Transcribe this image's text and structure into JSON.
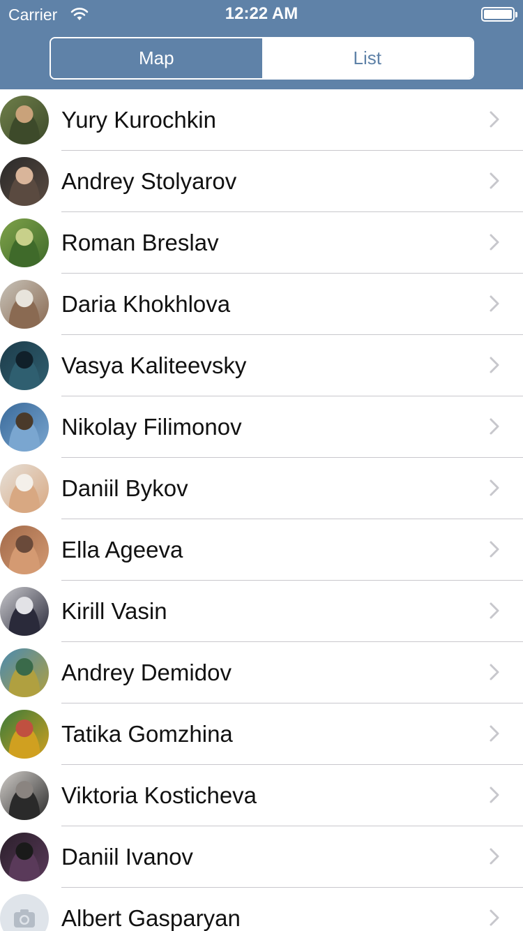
{
  "status_bar": {
    "carrier": "Carrier",
    "wifi_icon": "wifi-icon",
    "time": "12:22 AM",
    "battery_icon": "battery-icon",
    "battery_level": 1.0
  },
  "segmented_control": {
    "map_label": "Map",
    "list_label": "List",
    "selected": "Map"
  },
  "colors": {
    "header_bg": "#5f82a8",
    "separator": "#c8c7cc",
    "chevron": "#c7c7cc"
  },
  "contacts": [
    {
      "name": "Yury Kurochkin",
      "avatar": "photo"
    },
    {
      "name": "Andrey Stolyarov",
      "avatar": "photo"
    },
    {
      "name": "Roman Breslav",
      "avatar": "photo"
    },
    {
      "name": "Daria Khokhlova",
      "avatar": "photo"
    },
    {
      "name": "Vasya Kaliteevsky",
      "avatar": "photo"
    },
    {
      "name": "Nikolay Filimonov",
      "avatar": "photo"
    },
    {
      "name": "Daniil Bykov",
      "avatar": "photo"
    },
    {
      "name": "Ella Ageeva",
      "avatar": "photo"
    },
    {
      "name": "Kirill Vasin",
      "avatar": "photo"
    },
    {
      "name": "Andrey Demidov",
      "avatar": "photo"
    },
    {
      "name": "Tatika Gomzhina",
      "avatar": "photo"
    },
    {
      "name": "Viktoria Kosticheva",
      "avatar": "photo"
    },
    {
      "name": "Daniil Ivanov",
      "avatar": "photo"
    },
    {
      "name": "Albert Gasparyan",
      "avatar": "camera-placeholder-icon"
    }
  ]
}
